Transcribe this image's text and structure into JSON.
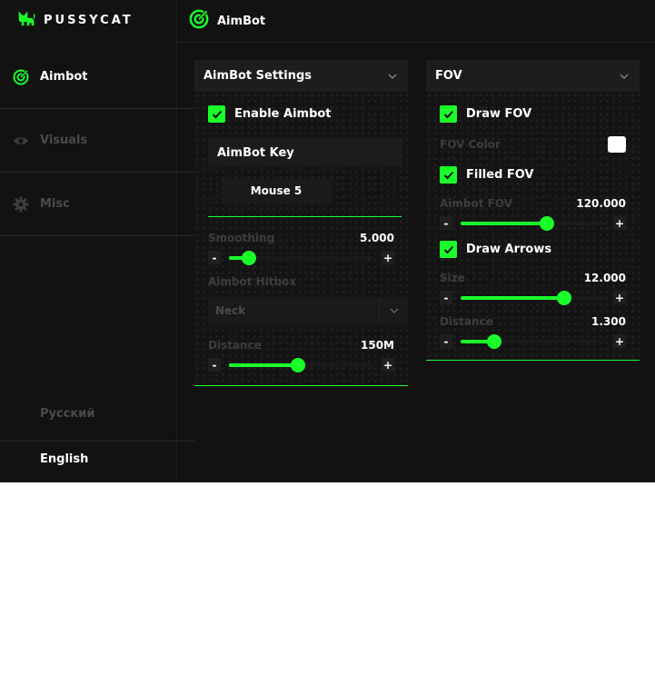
{
  "brand": {
    "name": "PUSSYCAT",
    "logo_icon": "cat-icon"
  },
  "header": {
    "title": "AimBot",
    "icon": "aimbot-icon"
  },
  "sidebar": {
    "items": [
      {
        "label": "Aimbot",
        "icon": "aimbot-icon",
        "active": true
      },
      {
        "label": "Visuals",
        "icon": "eye-icon",
        "active": false
      },
      {
        "label": "Misc",
        "icon": "gear-icon",
        "active": false
      }
    ],
    "languages": [
      {
        "label": "Русский",
        "active": false
      },
      {
        "label": "English",
        "active": true
      }
    ]
  },
  "aimbot_panel": {
    "title": "AimBot Settings",
    "enable": {
      "label": "Enable Aimbot",
      "checked": true
    },
    "key": {
      "label": "AimBot Key",
      "value": "Mouse 5"
    },
    "smoothing": {
      "label": "Smoothing",
      "value": "5.000",
      "fraction": 0.14
    },
    "hitbox": {
      "label": "Aimbot Hitbox",
      "value": "Neck"
    },
    "distance": {
      "label": "Distance",
      "value": "150M",
      "fraction": 0.48
    }
  },
  "fov_panel": {
    "title": "FOV",
    "draw_fov": {
      "label": "Draw FOV",
      "checked": true
    },
    "fov_color": {
      "label": "FOV Color",
      "color": "#ffffff"
    },
    "filled_fov": {
      "label": "Filled FOV",
      "checked": true
    },
    "aimbot_fov": {
      "label": "Aimbot FOV",
      "value": "120.000",
      "fraction": 0.6
    },
    "draw_arrows": {
      "label": "Draw Arrows",
      "checked": true
    },
    "size": {
      "label": "Size",
      "value": "12.000",
      "fraction": 0.72
    },
    "distance": {
      "label": "Distance",
      "value": "1.300",
      "fraction": 0.23
    }
  },
  "stepper": {
    "minus": "-",
    "plus": "+"
  },
  "colors": {
    "accent": "#1aff2a",
    "background": "#121212",
    "panel_header": "#1d1d1d",
    "muted_text": "#4a4a4a"
  }
}
